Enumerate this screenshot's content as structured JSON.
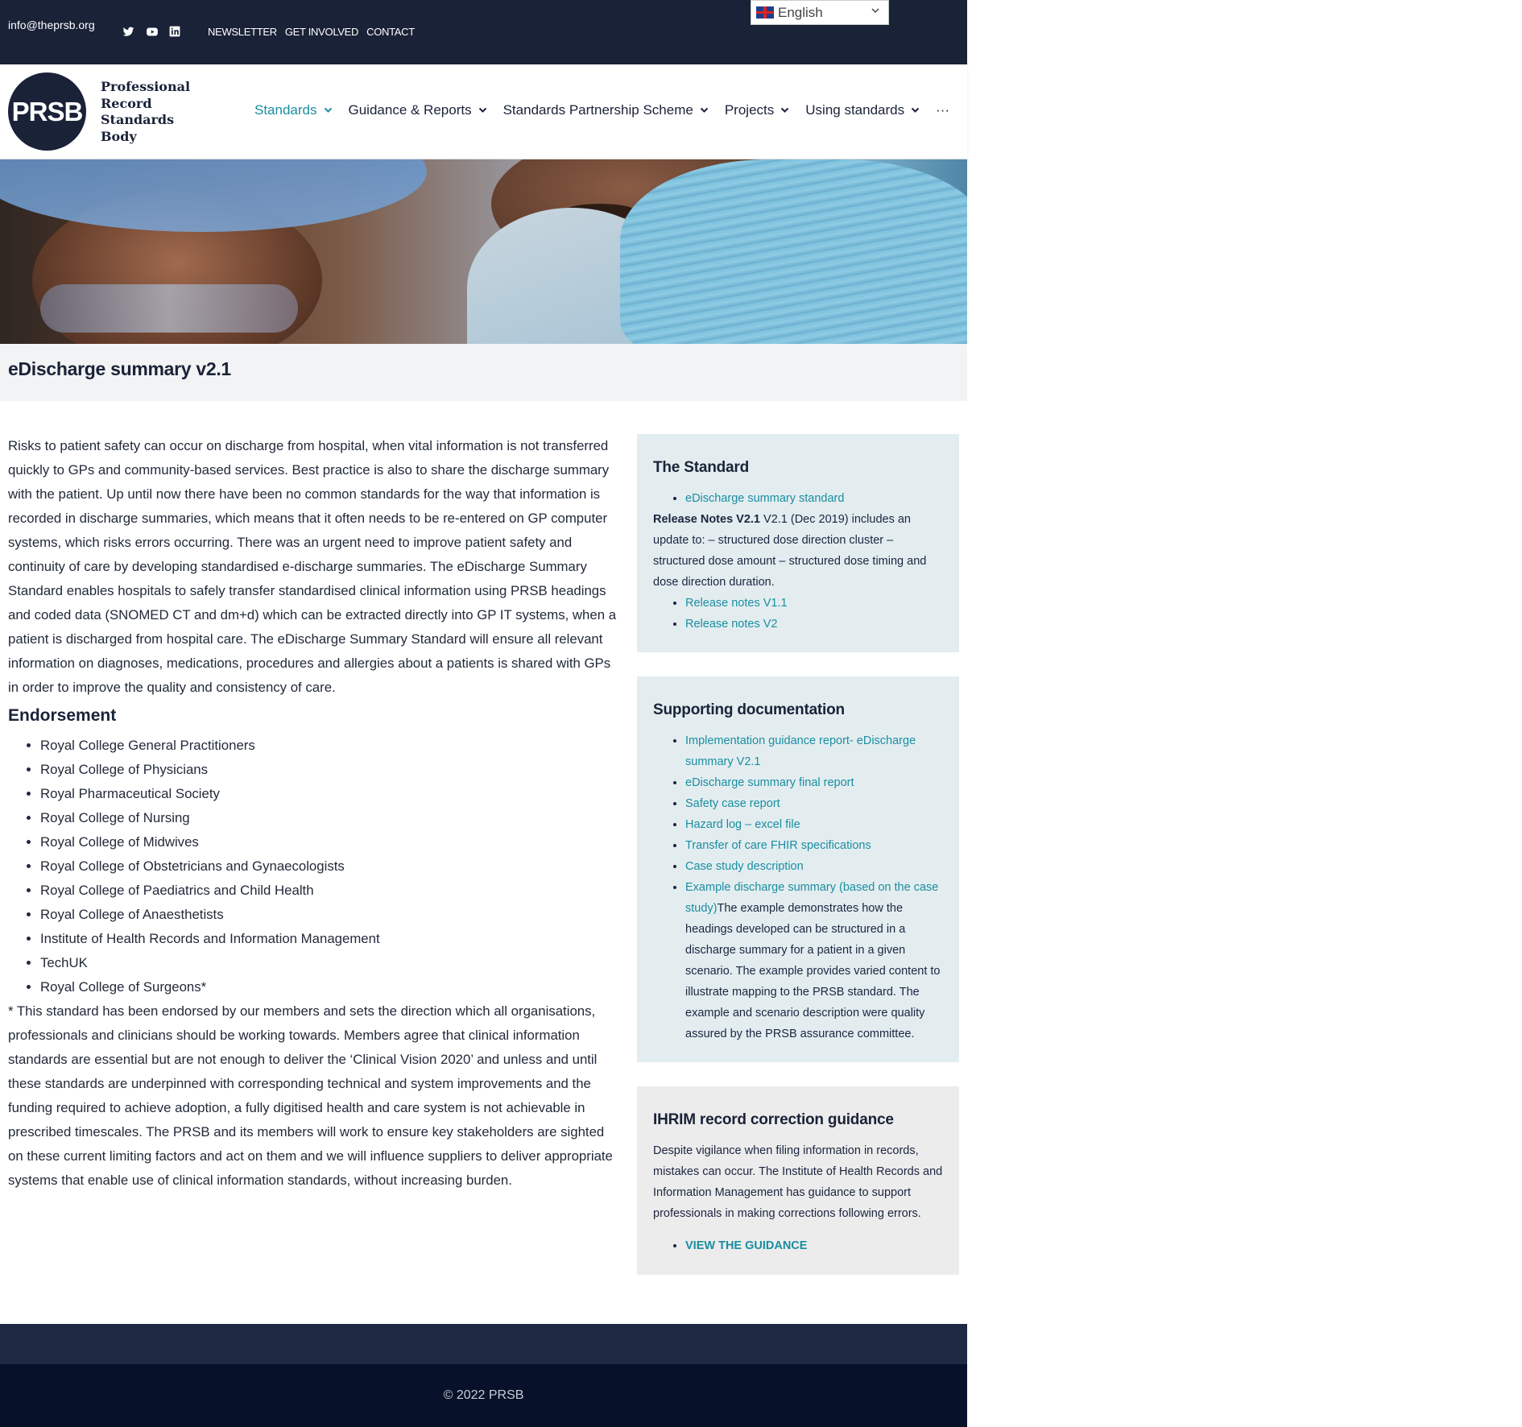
{
  "topbar": {
    "email": "info@theprsb.org",
    "social_icons": [
      "twitter-icon",
      "youtube-icon",
      "linkedin-icon"
    ],
    "links": [
      "NEWSLETTER",
      "GET INVOLVED",
      "CONTACT"
    ]
  },
  "language": {
    "selected": "English"
  },
  "logo": {
    "mark": "PRSB",
    "lines": [
      "Professional",
      "Record",
      "Standards",
      "Body"
    ]
  },
  "nav": {
    "items": [
      "Standards",
      "Guidance & Reports",
      "Standards Partnership Scheme",
      "Projects",
      "Using standards"
    ],
    "more": "···",
    "active_color": "#1a8ea0"
  },
  "page": {
    "title": "eDischarge summary v2.1"
  },
  "main": {
    "intro": "Risks to patient safety can occur on discharge from hospital, when vital information is not transferred quickly to GPs and community-based services. Best practice is also to share the discharge summary with the patient. Up until now there have been no common standards for the way that information is recorded in discharge summaries, which means that it often needs to be re-entered on GP computer systems, which risks errors occurring. There was an urgent need to improve patient safety and continuity of care by developing standardised e-discharge summaries. The eDischarge Summary Standard enables hospitals to safely transfer standardised clinical information using PRSB headings and coded data (SNOMED CT and dm+d) which can be extracted directly into GP IT systems, when a patient is discharged from hospital care. The eDischarge Summary Standard will ensure all relevant information on diagnoses, medications, procedures and allergies about a patients is shared with GPs in order to improve the quality and consistency of care.",
    "endorsement_heading": "Endorsement",
    "endorsements": [
      "Royal College General Practitioners",
      "Royal College of Physicians",
      "Royal Pharmaceutical Society",
      "Royal College of Nursing",
      "Royal College of Midwives",
      "Royal College of Obstetricians and Gynaecologists",
      "Royal College of Paediatrics and Child Health",
      "Royal College of Anaesthetists",
      "Institute of Health Records and Information Management",
      "TechUK",
      "Royal College of Surgeons*"
    ],
    "footnote": "* This standard has been endorsed by our members and sets the direction which all organisations, professionals and clinicians should be working towards. Members agree that clinical information standards are essential but are not enough to deliver the ‘Clinical Vision 2020’ and unless and until these standards are underpinned with corresponding technical and system improvements and the funding required to achieve adoption, a fully digitised health and care system is not achievable in prescribed timescales. The PRSB and its members will work to ensure key stakeholders are sighted on these current limiting factors and act on them and we will influence suppliers to deliver appropriate systems that enable use of clinical information standards, without increasing burden."
  },
  "sidebar": {
    "standard": {
      "heading": "The Standard",
      "link1": "eDischarge summary standard",
      "release_bold": "Release Notes V2.1",
      "release_text": " V2.1 (Dec 2019) includes an update to: – structured dose direction cluster – structured dose amount – structured dose timing and dose direction duration.",
      "links": [
        "Release notes V1.1",
        "Release notes V2"
      ]
    },
    "supporting": {
      "heading": "Supporting documentation",
      "links": [
        "Implementation guidance report- eDischarge summary V2.1",
        "eDischarge summary final report",
        "Safety case report",
        "Hazard log – excel file",
        "Transfer of care FHIR specifications",
        "Case study description"
      ],
      "example_link": "Example discharge summary (based on the case study)",
      "example_text": "The example demonstrates how the headings developed can be structured in a discharge summary for a patient in a given scenario. The example provides varied content to illustrate mapping to the PRSB standard. The example and scenario description were quality assured by the PRSB assurance committee."
    },
    "ihrim": {
      "heading": "IHRIM record correction guidance",
      "text": "Despite vigilance when filing information in records, mistakes can occur. The Institute of Health Records and Information Management has guidance to support professionals in making corrections following errors.",
      "link": "VIEW THE GUIDANCE"
    }
  },
  "footer": {
    "copyright": "© 2022 PRSB"
  }
}
